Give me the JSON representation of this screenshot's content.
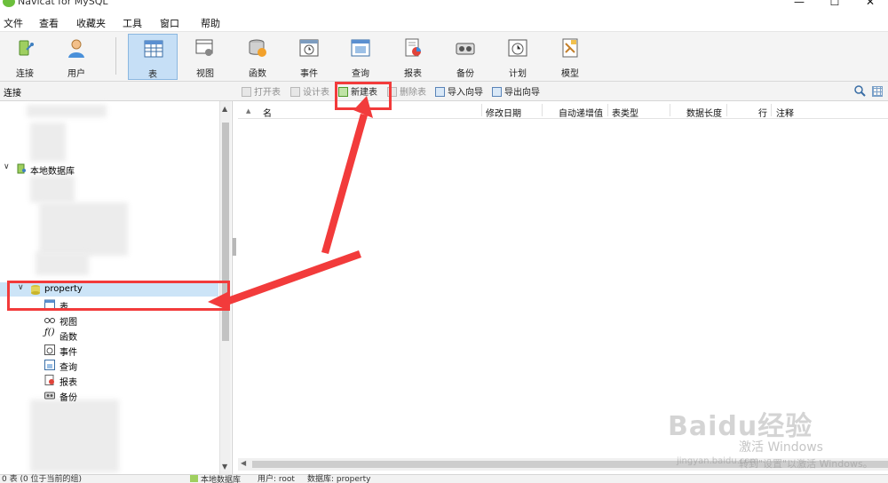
{
  "window": {
    "title": "Navicat for MySQL",
    "controls": [
      "—",
      "☐",
      "✕"
    ]
  },
  "menu": [
    "文件",
    "查看",
    "收藏夹",
    "工具",
    "窗口",
    "帮助"
  ],
  "toolbar": [
    {
      "label": "连接",
      "icon": "connection-icon"
    },
    {
      "label": "用户",
      "icon": "user-icon"
    },
    {
      "label": "表",
      "icon": "table-icon",
      "active": true
    },
    {
      "label": "视图",
      "icon": "view-icon"
    },
    {
      "label": "函数",
      "icon": "function-icon"
    },
    {
      "label": "事件",
      "icon": "event-icon"
    },
    {
      "label": "查询",
      "icon": "query-icon"
    },
    {
      "label": "报表",
      "icon": "report-icon"
    },
    {
      "label": "备份",
      "icon": "backup-icon"
    },
    {
      "label": "计划",
      "icon": "schedule-icon"
    },
    {
      "label": "模型",
      "icon": "model-icon"
    }
  ],
  "subbar": {
    "connection_label": "连接",
    "actions": [
      {
        "label": "打开表",
        "enabled": false
      },
      {
        "label": "设计表",
        "enabled": false
      },
      {
        "label": "新建表",
        "enabled": true
      },
      {
        "label": "删除表",
        "enabled": false
      },
      {
        "label": "导入向导",
        "enabled": true
      },
      {
        "label": "导出向导",
        "enabled": true
      }
    ]
  },
  "tree": {
    "connection": "本地数据库",
    "database": "property",
    "children": [
      "表",
      "视图",
      "函数",
      "事件",
      "查询",
      "报表",
      "备份"
    ]
  },
  "columns": [
    "名",
    "修改日期",
    "自动递增值",
    "表类型",
    "数据长度",
    "行",
    "注释"
  ],
  "status": {
    "left": "0 表 (0 位于当前的组)",
    "connection": "本地数据库",
    "user": "用户: root",
    "database": "数据库: property"
  },
  "watermark": {
    "logo": "Baidu经验",
    "line1": "激活 Windows",
    "line2": "jingyan.baidu.com",
    "line3": "转到\"设置\"以激活 Windows。"
  },
  "colors": {
    "accent": "#c6dff6",
    "annotation": "#f23b3b",
    "selected": "#cce4f7"
  }
}
